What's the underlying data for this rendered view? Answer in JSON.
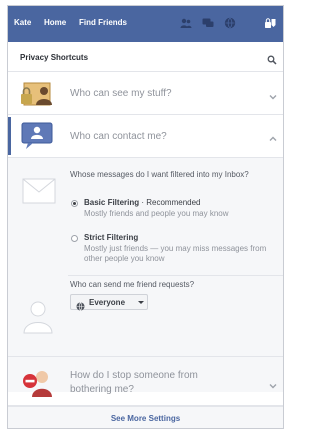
{
  "topbar": {
    "user_label": "Kate",
    "home_label": "Home",
    "find_friends_label": "Find Friends",
    "bg_color": "#4a66a0",
    "icons": [
      "friend-requests-icon",
      "messages-icon",
      "notifications-icon",
      "privacy-shortcuts-icon"
    ]
  },
  "panel": {
    "title": "Privacy Shortcuts",
    "rows": [
      {
        "label": "Who can see my stuff?",
        "icon": "padlock-people-icon",
        "expanded": false
      },
      {
        "label": "Who can contact me?",
        "icon": "chat-bubbles-icon",
        "expanded": true
      },
      {
        "label": "How do I stop someone from bothering me?",
        "icon": "block-user-icon",
        "expanded": false
      }
    ],
    "contact": {
      "messages_question": "Whose messages do I want filtered into my Inbox?",
      "options": [
        {
          "title": "Basic Filtering",
          "suffix": " · Recommended",
          "description": "Mostly friends and people you may know",
          "selected": true
        },
        {
          "title": "Strict Filtering",
          "suffix": "",
          "description": "Mostly just friends — you may miss messages from other people you know",
          "selected": false
        }
      ],
      "friend_request_question": "Who can send me friend requests?",
      "friend_request_value": "Everyone"
    },
    "footer_label": "See More Settings"
  }
}
